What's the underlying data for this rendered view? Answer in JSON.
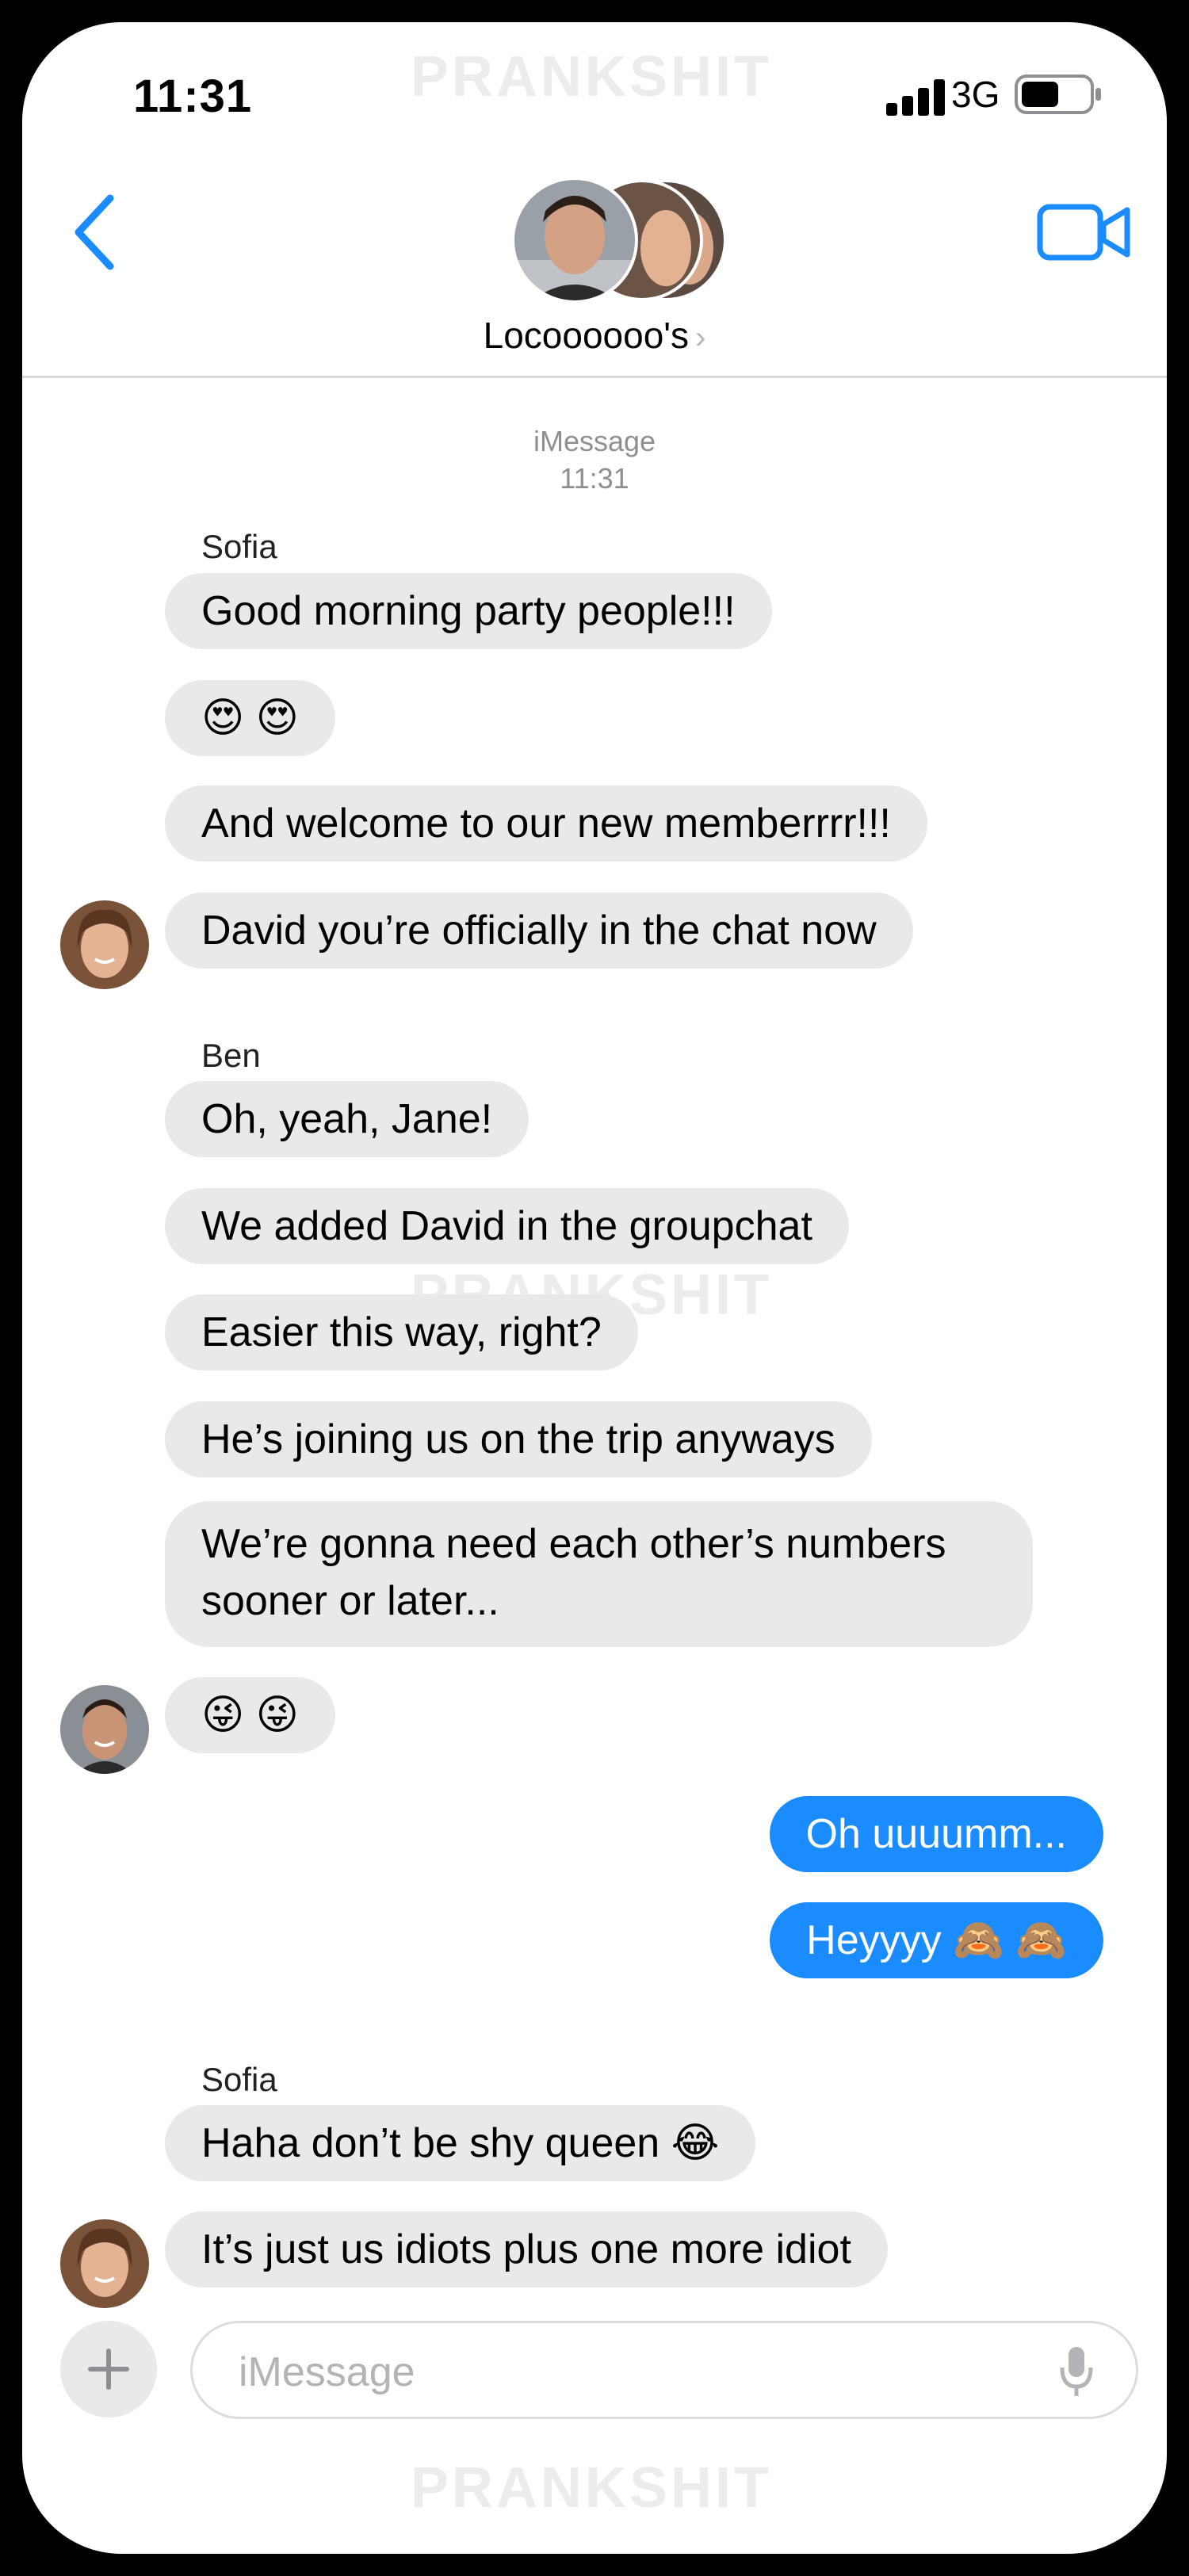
{
  "status_bar": {
    "time": "11:31",
    "network": "3G"
  },
  "watermark": "PRANKSHIT",
  "header": {
    "title": "Locoooooo's"
  },
  "timestamp": {
    "service": "iMessage",
    "time": "11:31"
  },
  "groups": [
    {
      "sender": "Sofia",
      "messages": [
        "Good morning party people!!!",
        "😍 😍",
        "And welcome to our new memberrrr!!!",
        "David you’re officially in the chat now"
      ]
    },
    {
      "sender": "Ben",
      "messages": [
        "Oh, yeah, Jane!",
        "We added David in the groupchat",
        "Easier this way, right?",
        "He’s joining us on the trip anyways",
        "We’re gonna need each other’s numbers sooner or later...",
        "😜 😜"
      ]
    },
    {
      "sender": "me",
      "messages": [
        "Oh uuuumm...",
        "Heyyyy 🙈 🙈"
      ]
    },
    {
      "sender": "Sofia",
      "messages": [
        "Haha don’t be shy queen 😂",
        "It’s just us idiots plus one more idiot"
      ]
    }
  ],
  "composer": {
    "placeholder": "iMessage"
  },
  "colors": {
    "accent": "#1a8cff",
    "received_bubble": "#e9e9eb"
  }
}
